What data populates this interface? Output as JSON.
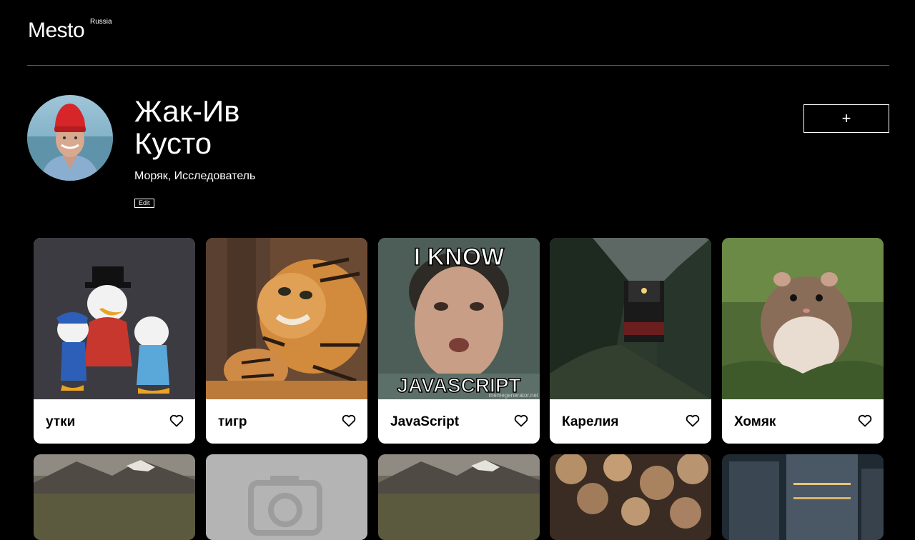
{
  "header": {
    "logo": "Mesto",
    "logo_sup": "Russia"
  },
  "profile": {
    "name": "Жак-Ив Кусто",
    "about": "Моряк, Исследователь",
    "edit_label": "Edit",
    "add_label": "+"
  },
  "cards": [
    {
      "title": "утки",
      "image": "ducks-image"
    },
    {
      "title": "тигр",
      "image": "tiger-image"
    },
    {
      "title": "JavaScript",
      "image": "meme-image",
      "meme_top": "I KNOW",
      "meme_bottom": "JAVASCRIPT",
      "watermark": "memegenerator.net"
    },
    {
      "title": "Карелия",
      "image": "train-forest-image"
    },
    {
      "title": "Хомяк",
      "image": "hamster-image"
    }
  ],
  "colors": {
    "background": "#000000",
    "card": "#ffffff",
    "divider": "#5a5a5a"
  }
}
